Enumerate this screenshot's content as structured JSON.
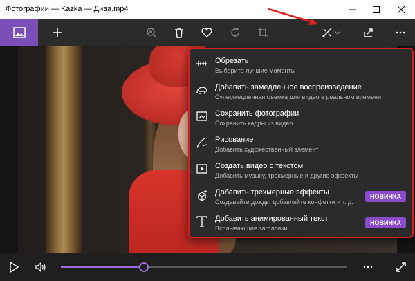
{
  "window": {
    "title": "Фотографии — Kazka — Дива.mp4"
  },
  "toolbar": {
    "icons": [
      "picture-icon",
      "plus-icon",
      "zoom-icon",
      "trash-icon",
      "heart-icon",
      "rotate-icon",
      "crop-icon",
      "edit-create-icon",
      "chevron-down-icon",
      "share-icon",
      "more-icon"
    ]
  },
  "menu": {
    "items": [
      {
        "title": "Обрезать",
        "subtitle": "Выберите лучшие моменты",
        "icon": "trim-icon",
        "badge": ""
      },
      {
        "title": "Добавить замедленное воспроизведение",
        "subtitle": "Супермедленная съемка для видео в реальном времени",
        "icon": "slow-motion-icon",
        "badge": ""
      },
      {
        "title": "Сохранить фотографии",
        "subtitle": "Сохранить кадры из видео",
        "icon": "save-photo-icon",
        "badge": ""
      },
      {
        "title": "Рисование",
        "subtitle": "Добавить художественный элемент",
        "icon": "pen-icon",
        "badge": ""
      },
      {
        "title": "Создать видео с текстом",
        "subtitle": "Добавить музыку, трехмерные и другие эффекты",
        "icon": "video-text-icon",
        "badge": ""
      },
      {
        "title": "Добавить трехмерные эффекты",
        "subtitle": "Создавайте дождь, добавляйте конфетти и т. д.",
        "icon": "3d-effects-icon",
        "badge": "НОВИНКА"
      },
      {
        "title": "Добавить анимированный текст",
        "subtitle": "Всплывающие заголовки",
        "icon": "animated-text-icon",
        "badge": "НОВИНКА"
      }
    ]
  },
  "player": {
    "progress": 0.29
  },
  "colors": {
    "accent": "#7a50b8",
    "badge": "#8a4ccc",
    "highlight_border": "#d61e1e"
  }
}
